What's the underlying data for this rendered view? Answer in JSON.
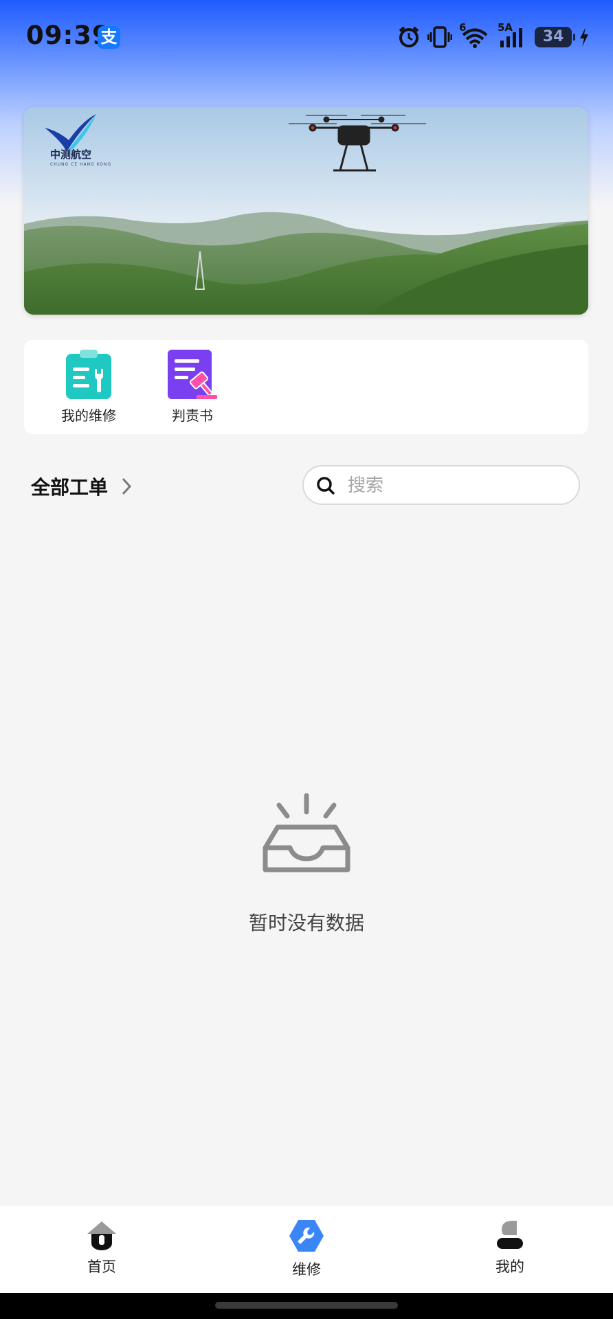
{
  "status_bar": {
    "time": "09:39",
    "alipay_badge": "支",
    "network_6": "6",
    "network_5a": "5A",
    "battery_level": "34"
  },
  "banner": {
    "logo_text": "中测航空",
    "logo_subtext": "CHUNG CE HANG KONG"
  },
  "quick_menu": {
    "items": [
      {
        "label": "我的维修",
        "icon": "clipboard-wrench-icon",
        "color": "#1fc8c0"
      },
      {
        "label": "判责书",
        "icon": "document-gavel-icon",
        "color": "#7b3ff2"
      }
    ]
  },
  "work_orders": {
    "title": "全部工单",
    "search_placeholder": "搜索"
  },
  "empty_state": {
    "text": "暂时没有数据",
    "icon": "empty-inbox-icon"
  },
  "tab_bar": {
    "tabs": [
      {
        "label": "首页",
        "icon": "home-icon"
      },
      {
        "label": "维修",
        "icon": "wrench-hexagon-icon",
        "active": true,
        "color": "#3b86f7"
      },
      {
        "label": "我的",
        "icon": "user-icon"
      }
    ]
  }
}
